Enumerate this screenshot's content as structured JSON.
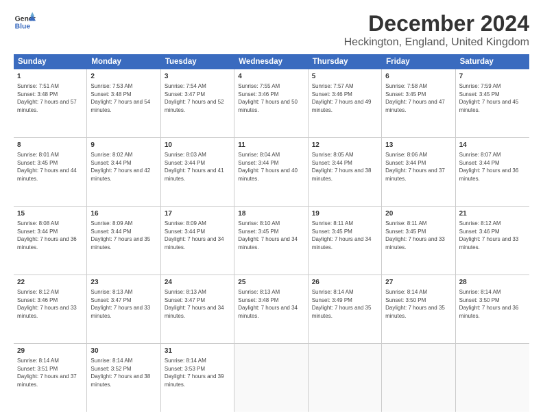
{
  "logo": {
    "line1": "General",
    "line2": "Blue"
  },
  "title": "December 2024",
  "subtitle": "Heckington, England, United Kingdom",
  "days": [
    "Sunday",
    "Monday",
    "Tuesday",
    "Wednesday",
    "Thursday",
    "Friday",
    "Saturday"
  ],
  "weeks": [
    [
      {
        "num": "1",
        "sunrise": "Sunrise: 7:51 AM",
        "sunset": "Sunset: 3:48 PM",
        "daylight": "Daylight: 7 hours and 57 minutes."
      },
      {
        "num": "2",
        "sunrise": "Sunrise: 7:53 AM",
        "sunset": "Sunset: 3:48 PM",
        "daylight": "Daylight: 7 hours and 54 minutes."
      },
      {
        "num": "3",
        "sunrise": "Sunrise: 7:54 AM",
        "sunset": "Sunset: 3:47 PM",
        "daylight": "Daylight: 7 hours and 52 minutes."
      },
      {
        "num": "4",
        "sunrise": "Sunrise: 7:55 AM",
        "sunset": "Sunset: 3:46 PM",
        "daylight": "Daylight: 7 hours and 50 minutes."
      },
      {
        "num": "5",
        "sunrise": "Sunrise: 7:57 AM",
        "sunset": "Sunset: 3:46 PM",
        "daylight": "Daylight: 7 hours and 49 minutes."
      },
      {
        "num": "6",
        "sunrise": "Sunrise: 7:58 AM",
        "sunset": "Sunset: 3:45 PM",
        "daylight": "Daylight: 7 hours and 47 minutes."
      },
      {
        "num": "7",
        "sunrise": "Sunrise: 7:59 AM",
        "sunset": "Sunset: 3:45 PM",
        "daylight": "Daylight: 7 hours and 45 minutes."
      }
    ],
    [
      {
        "num": "8",
        "sunrise": "Sunrise: 8:01 AM",
        "sunset": "Sunset: 3:45 PM",
        "daylight": "Daylight: 7 hours and 44 minutes."
      },
      {
        "num": "9",
        "sunrise": "Sunrise: 8:02 AM",
        "sunset": "Sunset: 3:44 PM",
        "daylight": "Daylight: 7 hours and 42 minutes."
      },
      {
        "num": "10",
        "sunrise": "Sunrise: 8:03 AM",
        "sunset": "Sunset: 3:44 PM",
        "daylight": "Daylight: 7 hours and 41 minutes."
      },
      {
        "num": "11",
        "sunrise": "Sunrise: 8:04 AM",
        "sunset": "Sunset: 3:44 PM",
        "daylight": "Daylight: 7 hours and 40 minutes."
      },
      {
        "num": "12",
        "sunrise": "Sunrise: 8:05 AM",
        "sunset": "Sunset: 3:44 PM",
        "daylight": "Daylight: 7 hours and 38 minutes."
      },
      {
        "num": "13",
        "sunrise": "Sunrise: 8:06 AM",
        "sunset": "Sunset: 3:44 PM",
        "daylight": "Daylight: 7 hours and 37 minutes."
      },
      {
        "num": "14",
        "sunrise": "Sunrise: 8:07 AM",
        "sunset": "Sunset: 3:44 PM",
        "daylight": "Daylight: 7 hours and 36 minutes."
      }
    ],
    [
      {
        "num": "15",
        "sunrise": "Sunrise: 8:08 AM",
        "sunset": "Sunset: 3:44 PM",
        "daylight": "Daylight: 7 hours and 36 minutes."
      },
      {
        "num": "16",
        "sunrise": "Sunrise: 8:09 AM",
        "sunset": "Sunset: 3:44 PM",
        "daylight": "Daylight: 7 hours and 35 minutes."
      },
      {
        "num": "17",
        "sunrise": "Sunrise: 8:09 AM",
        "sunset": "Sunset: 3:44 PM",
        "daylight": "Daylight: 7 hours and 34 minutes."
      },
      {
        "num": "18",
        "sunrise": "Sunrise: 8:10 AM",
        "sunset": "Sunset: 3:45 PM",
        "daylight": "Daylight: 7 hours and 34 minutes."
      },
      {
        "num": "19",
        "sunrise": "Sunrise: 8:11 AM",
        "sunset": "Sunset: 3:45 PM",
        "daylight": "Daylight: 7 hours and 34 minutes."
      },
      {
        "num": "20",
        "sunrise": "Sunrise: 8:11 AM",
        "sunset": "Sunset: 3:45 PM",
        "daylight": "Daylight: 7 hours and 33 minutes."
      },
      {
        "num": "21",
        "sunrise": "Sunrise: 8:12 AM",
        "sunset": "Sunset: 3:46 PM",
        "daylight": "Daylight: 7 hours and 33 minutes."
      }
    ],
    [
      {
        "num": "22",
        "sunrise": "Sunrise: 8:12 AM",
        "sunset": "Sunset: 3:46 PM",
        "daylight": "Daylight: 7 hours and 33 minutes."
      },
      {
        "num": "23",
        "sunrise": "Sunrise: 8:13 AM",
        "sunset": "Sunset: 3:47 PM",
        "daylight": "Daylight: 7 hours and 33 minutes."
      },
      {
        "num": "24",
        "sunrise": "Sunrise: 8:13 AM",
        "sunset": "Sunset: 3:47 PM",
        "daylight": "Daylight: 7 hours and 34 minutes."
      },
      {
        "num": "25",
        "sunrise": "Sunrise: 8:13 AM",
        "sunset": "Sunset: 3:48 PM",
        "daylight": "Daylight: 7 hours and 34 minutes."
      },
      {
        "num": "26",
        "sunrise": "Sunrise: 8:14 AM",
        "sunset": "Sunset: 3:49 PM",
        "daylight": "Daylight: 7 hours and 35 minutes."
      },
      {
        "num": "27",
        "sunrise": "Sunrise: 8:14 AM",
        "sunset": "Sunset: 3:50 PM",
        "daylight": "Daylight: 7 hours and 35 minutes."
      },
      {
        "num": "28",
        "sunrise": "Sunrise: 8:14 AM",
        "sunset": "Sunset: 3:50 PM",
        "daylight": "Daylight: 7 hours and 36 minutes."
      }
    ],
    [
      {
        "num": "29",
        "sunrise": "Sunrise: 8:14 AM",
        "sunset": "Sunset: 3:51 PM",
        "daylight": "Daylight: 7 hours and 37 minutes."
      },
      {
        "num": "30",
        "sunrise": "Sunrise: 8:14 AM",
        "sunset": "Sunset: 3:52 PM",
        "daylight": "Daylight: 7 hours and 38 minutes."
      },
      {
        "num": "31",
        "sunrise": "Sunrise: 8:14 AM",
        "sunset": "Sunset: 3:53 PM",
        "daylight": "Daylight: 7 hours and 39 minutes."
      },
      null,
      null,
      null,
      null
    ]
  ]
}
